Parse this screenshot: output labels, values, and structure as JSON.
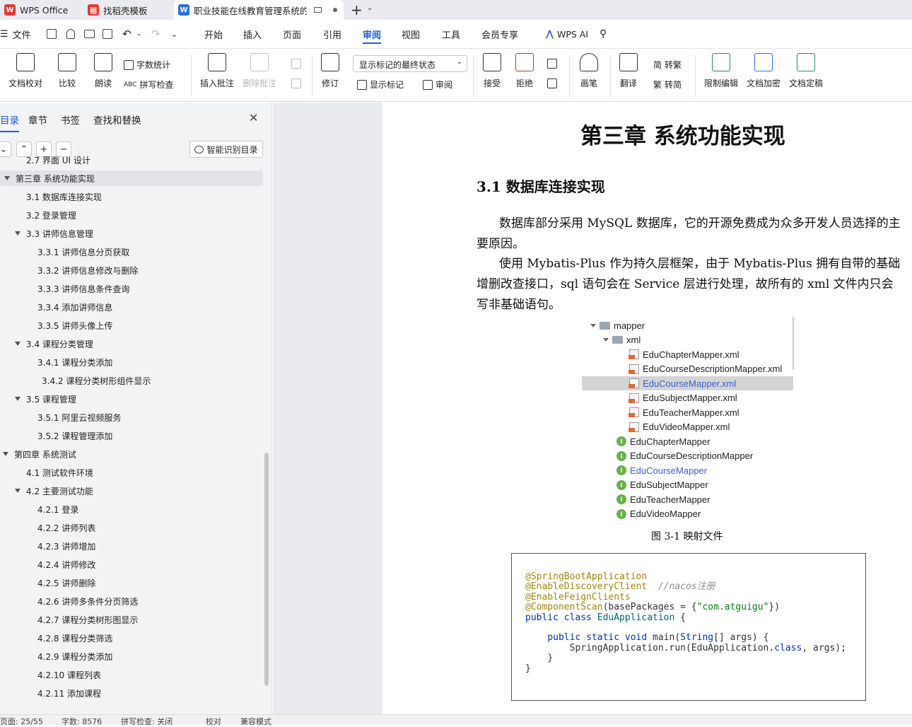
{
  "tabs": {
    "wps": "WPS Office",
    "template": "找稻壳模板",
    "doc": "职业技能在线教育管理系统的"
  },
  "menu": {
    "file": "文件",
    "items": [
      "开始",
      "插入",
      "页面",
      "引用",
      "审阅",
      "视图",
      "工具",
      "会员专享"
    ],
    "ai": "WPS AI"
  },
  "ribbon": {
    "proofread": "文档校对",
    "compare": "比较",
    "read_aloud": "朗读",
    "word_count": "字数统计",
    "spell_check": "拼写检查",
    "insert_comment": "插入批注",
    "delete_comment": "删除批注",
    "revise": "修订",
    "display_state": "显示标记的最终状态",
    "show_markup": "显示标记",
    "review": "审阅",
    "accept": "接受",
    "reject": "拒绝",
    "pen": "画笔",
    "translate": "翻译",
    "to_simplified": "转繁",
    "to_traditional": "转简",
    "restrict_edit": "限制编辑",
    "encrypt": "文档加密",
    "finalize": "文档定稿"
  },
  "sidebar": {
    "tabs": [
      "目录",
      "章节",
      "书签",
      "查找和替换"
    ],
    "smart_toc": "智能识别目录",
    "items": [
      {
        "label": "2.7 界面 UI 设计",
        "level": 2
      },
      {
        "label": "第三章  系统功能实现",
        "level": 1
      },
      {
        "label": "3.1 数据库连接实现",
        "level": 2
      },
      {
        "label": "3.2 登录管理",
        "level": 2
      },
      {
        "label": "3.3 讲师信息管理",
        "level": 2
      },
      {
        "label": "3.3.1 讲师信息分页获取",
        "level": 3
      },
      {
        "label": "3.3.2 讲师信息修改与删除",
        "level": 3
      },
      {
        "label": "3.3.3 讲师信息条件查询",
        "level": 3
      },
      {
        "label": "3.3.4 添加讲师信息",
        "level": 3
      },
      {
        "label": "3.3.5 讲师头像上传",
        "level": 3
      },
      {
        "label": "3.4 课程分类管理",
        "level": 2
      },
      {
        "label": "3.4.1 课程分类添加",
        "level": 3
      },
      {
        "label": "3.4.2 课程分类树形组件显示",
        "level": 3
      },
      {
        "label": "3.5 课程管理",
        "level": 2
      },
      {
        "label": "3.5.1 阿里云视频服务",
        "level": 3
      },
      {
        "label": "3.5.2  课程管理添加",
        "level": 3
      },
      {
        "label": "第四章  系统测试",
        "level": 1
      },
      {
        "label": "4.1 测试软件环境",
        "level": 2
      },
      {
        "label": "4.2 主要测试功能",
        "level": 2
      },
      {
        "label": "4.2.1  登录",
        "level": 3
      },
      {
        "label": "4.2.2 讲师列表",
        "level": 3
      },
      {
        "label": "4.2.3 讲师增加",
        "level": 3
      },
      {
        "label": "4.2.4 讲师修改",
        "level": 3
      },
      {
        "label": "4.2.5 讲师删除",
        "level": 3
      },
      {
        "label": "4.2.6 讲师多条件分页筛选",
        "level": 3
      },
      {
        "label": "4.2.7 课程分类树形图显示",
        "level": 3
      },
      {
        "label": "4.2.8 课程分类筛选",
        "level": 3
      },
      {
        "label": "4.2.9 课程分类添加",
        "level": 3
      },
      {
        "label": "4.2.10 课程列表",
        "level": 3
      },
      {
        "label": "4.2.11 添加课程",
        "level": 3
      }
    ]
  },
  "document": {
    "chapter_title": "第三章  系统功能实现",
    "section_title": "3.1 数据库连接实现",
    "para1": "数据库部分采用 MySQL 数据库，它的开源免费成为众多开发人员选择的主要原因。",
    "para2": "使用 Mybatis-Plus 作为持久层框架，由于 Mybatis-Plus 拥有自带的基础增删改查接口，sql 语句会在 Service 层进行处理，故所有的 xml 文件内只会写非基础语句。",
    "tree": {
      "mapper": "mapper",
      "xml": "xml",
      "xml_files": [
        "EduChapterMapper.xml",
        "EduCourseDescriptionMapper.xml",
        "EduCourseMapper.xml",
        "EduSubjectMapper.xml",
        "EduTeacherMapper.xml",
        "EduVideoMapper.xml"
      ],
      "interfaces": [
        "EduChapterMapper",
        "EduCourseDescriptionMapper",
        "EduCourseMapper",
        "EduSubjectMapper",
        "EduTeacherMapper",
        "EduVideoMapper"
      ]
    },
    "figure_caption": "图 3-1 映射文件",
    "code": {
      "a1": "@SpringBootApplication",
      "a2": "@EnableDiscoveryClient",
      "comment": "//nacos注册",
      "a3": "@EnableFeignClients",
      "a4": "@ComponentScan",
      "a4rest": "(basePackages = {",
      "pkg": "\"com.atguigu\"",
      "a4end": "})",
      "kw_public_class": "public class",
      "classname": "EduApplication",
      "brace_open": " {",
      "kw_main": "public static void",
      "main_rest": " main(",
      "string_type": "String",
      "args": "[] args) {",
      "run_line": "SpringApplication.run(EduApplication.",
      "kw_class": "class",
      "run_end": ", args);",
      "inner_close": "}",
      "outer_close": "}"
    }
  },
  "status": {
    "page": "页面: 25/55",
    "words": "字数: 8576",
    "spell": "拼写检查: 关闭",
    "proof": "校对",
    "compat": "兼容模式"
  }
}
